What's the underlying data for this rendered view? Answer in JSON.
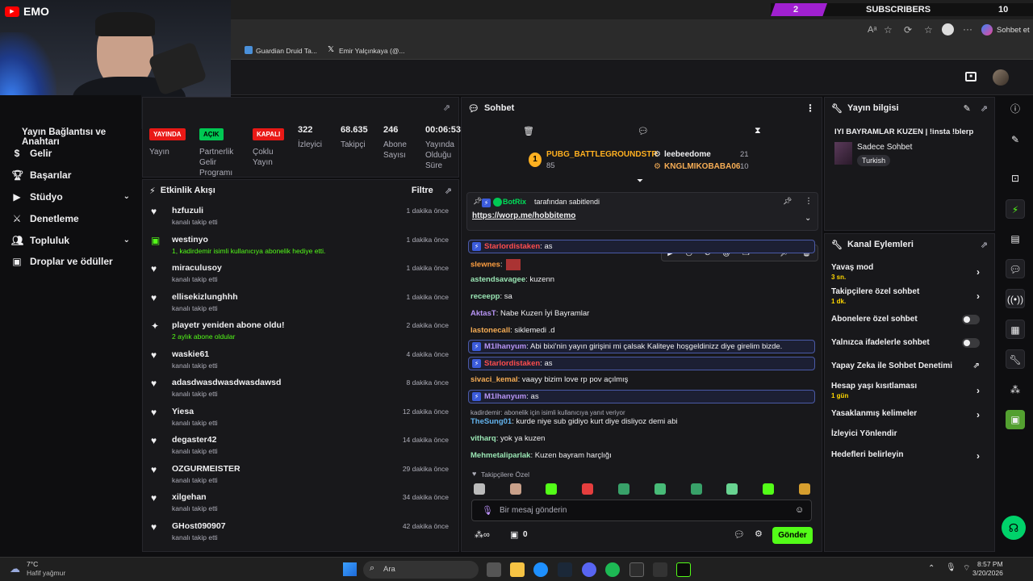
{
  "overlay": {
    "name": "EMO",
    "subs_count": "2",
    "subs_label": "SUBSCRIBERS",
    "subs_goal": "10"
  },
  "browser": {
    "address_right": "Sohbet et",
    "bookmarks": [
      "Guardian Druid Ta...",
      "Emir Yalçınkaya (@..."
    ]
  },
  "sidebar": {
    "title": "Yayın Bağlantısı ve Anahtarı",
    "items": [
      {
        "label": "Gelir",
        "icon": "dollar-icon"
      },
      {
        "label": "Başarılar",
        "icon": "trophy-icon"
      },
      {
        "label": "Stüdyo",
        "icon": "video-icon",
        "chevron": true
      },
      {
        "label": "Denetleme",
        "icon": "sword-icon"
      },
      {
        "label": "Topluluk",
        "icon": "people-icon",
        "chevron": true
      },
      {
        "label": "Droplar ve ödüller",
        "icon": "gift-icon"
      }
    ]
  },
  "stats": {
    "live_pill": "YAYINDA",
    "live_label": "Yayın",
    "partner_pill": "AÇIK",
    "partner_label": "Partnerlik Gelir Programı",
    "multi_pill": "KAPALI",
    "multi_label": "Çoklu Yayın",
    "viewers": "322",
    "viewers_label": "İzleyici",
    "followers": "68.635",
    "followers_label": "Takipçi",
    "subs": "246",
    "subs_label": "Abone Sayısı",
    "uptime": "00:06:53",
    "uptime_label": "Yayında Olduğu Süre"
  },
  "activity": {
    "title": "Etkinlik Akışı",
    "filter": "Filtre",
    "items": [
      {
        "name": "hzfuzuli",
        "desc": "kanalı takip etti",
        "time": "1 dakika önce",
        "icon": "heart-icon"
      },
      {
        "name": "westinyo",
        "desc": "1, kadirdemir isimli kullanıcıya abonelik hediye etti.",
        "time": "1 dakika önce",
        "icon": "gift-icon"
      },
      {
        "name": "miraculusoy",
        "desc": "kanalı takip etti",
        "time": "1 dakika önce",
        "icon": "heart-icon"
      },
      {
        "name": "ellisekizlunghhh",
        "desc": "kanalı takip etti",
        "time": "1 dakika önce",
        "icon": "heart-icon"
      },
      {
        "name": "playetr yeniden abone oldu!",
        "desc": "2 aylık abone oldular",
        "time": "2 dakika önce",
        "icon": "sparkle-icon"
      },
      {
        "name": "waskie61",
        "desc": "kanalı takip etti",
        "time": "4 dakika önce",
        "icon": "heart-icon"
      },
      {
        "name": "adasdwasdwasdwasdawsd",
        "desc": "kanalı takip etti",
        "time": "8 dakika önce",
        "icon": "heart-icon"
      },
      {
        "name": "Yiesa",
        "desc": "kanalı takip etti",
        "time": "12 dakika önce",
        "icon": "heart-icon"
      },
      {
        "name": "degaster42",
        "desc": "kanalı takip etti",
        "time": "14 dakika önce",
        "icon": "heart-icon"
      },
      {
        "name": "OZGURMEISTER",
        "desc": "kanalı takip etti",
        "time": "29 dakika önce",
        "icon": "heart-icon"
      },
      {
        "name": "xilgehan",
        "desc": "kanalı takip etti",
        "time": "34 dakika önce",
        "icon": "heart-icon"
      },
      {
        "name": "GHost090907",
        "desc": "kanalı takip etti",
        "time": "42 dakika önce",
        "icon": "heart-icon"
      }
    ]
  },
  "chat": {
    "title": "Sohbet",
    "leader1": {
      "name": "PUBG_BATTLEGROUNDSTR",
      "value": "85",
      "rank": "1"
    },
    "leader2": {
      "name": "leebeedome",
      "value": "21"
    },
    "leader3": {
      "name": "KNGLMIKOBABA06",
      "value": "10"
    },
    "pinned_by": "BotRix",
    "pinned_suffix": "tarafından sabitlendi",
    "pinned_link": "https://worp.me/hobbitemo",
    "messages": [
      {
        "user": "Starlordistaken",
        "text": ": as",
        "color": "#ff4d4d",
        "highlight": true
      },
      {
        "user": "slewnes",
        "text": ":",
        "color": "#ff9f40"
      },
      {
        "user": "astendsavagee",
        "text": ": kuzenn",
        "color": "#9ae6b4"
      },
      {
        "user": "receepp",
        "text": ": sa",
        "color": "#9ae6b4"
      },
      {
        "user": "AktasT",
        "text": ": Nabe Kuzen İyi Bayramlar",
        "color": "#b794f4"
      },
      {
        "user": "lastonecall",
        "text": ": siklemedi .d",
        "color": "#f6ad55"
      },
      {
        "user": "M1lhanyum",
        "text": ": Abi bixi'nin yayın girişini mi çalsak Kaliteye hoşgeldinizz diye girelim bizde.",
        "color": "#b794f4",
        "highlight": true
      },
      {
        "user": "Starlordistaken",
        "text": ": as",
        "color": "#ff4d4d",
        "highlight": true
      },
      {
        "user": "sivaci_kemal",
        "text": ": vaayy bizim love rp pov açılmış",
        "color": "#f6ad55"
      },
      {
        "user": "M1lhanyum",
        "text": ": as",
        "color": "#b794f4",
        "highlight": true
      },
      {
        "user": "TheSung01",
        "text": ": kurde niye sub gidiyo kurt diye disliyoz demi abi",
        "color": "#63b3ed"
      },
      {
        "user": "vitharq",
        "text": ": yok ya kuzen",
        "color": "#9ae6b4"
      },
      {
        "user": "Mehmetaliparlak",
        "text": ": Kuzen bayram harçlığı",
        "color": "#9ae6b4"
      }
    ],
    "reply_context": "kadirdemir: abonelik için isimli kullanıcıya yanıt veriyor",
    "followers_only": "Takipçilere Özel",
    "input_placeholder": "Bir mesaj gönderin",
    "send": "Gönder",
    "points": "0"
  },
  "stream_info": {
    "title": "Yayın bilgisi",
    "stream_title": "IYI BAYRAMLAR KUZEN | !insta !blerp",
    "category": "Sadece Sohbet",
    "tag": "Turkish"
  },
  "channel_actions": {
    "title": "Kanal Eylemleri",
    "slow_mode": "Yavaş mod",
    "slow_mode_val": "3 sn.",
    "followers_chat": "Takipçilere özel sohbet",
    "followers_chat_val": "1 dk.",
    "subs_chat": "Abonelere özel sohbet",
    "emote_chat": "Yalnızca ifadelerle sohbet",
    "ai_mod": "Yapay Zeka ile Sohbet Denetimi",
    "age_limit": "Hesap yaşı kısıtlaması",
    "age_limit_val": "1 gün",
    "banned_words": "Yasaklanmış kelimeler",
    "redirect": "İzleyici Yönlendir",
    "goals": "Hedefleri belirleyin"
  },
  "taskbar": {
    "weather_temp": "7°C",
    "weather_desc": "Hafif yağmur",
    "search": "Ara",
    "time": "8:57 PM",
    "date": "3/20/2026"
  }
}
